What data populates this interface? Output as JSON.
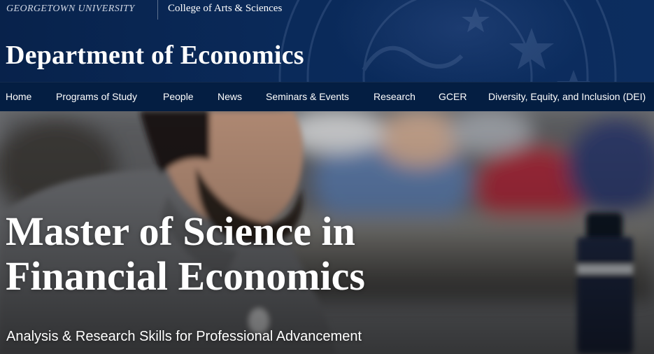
{
  "header": {
    "university": "GEORGETOWN UNIVERSITY",
    "college": "College of Arts & Sciences",
    "department": "Department of Economics"
  },
  "nav": {
    "items": [
      {
        "label": "Home"
      },
      {
        "label": "Programs of Study"
      },
      {
        "label": "People"
      },
      {
        "label": "News"
      },
      {
        "label": "Seminars & Events"
      },
      {
        "label": "Research"
      },
      {
        "label": "GCER"
      },
      {
        "label": "Diversity, Equity, and Inclusion (DEI)"
      }
    ]
  },
  "hero": {
    "title_line1": "Master of Science in",
    "title_line2": "Financial Economics",
    "subtitle": "Analysis & Research Skills for Professional Advancement"
  },
  "colors": {
    "navy": "#041e42",
    "header_blue": "#0a2a5a",
    "text": "#ffffff"
  }
}
